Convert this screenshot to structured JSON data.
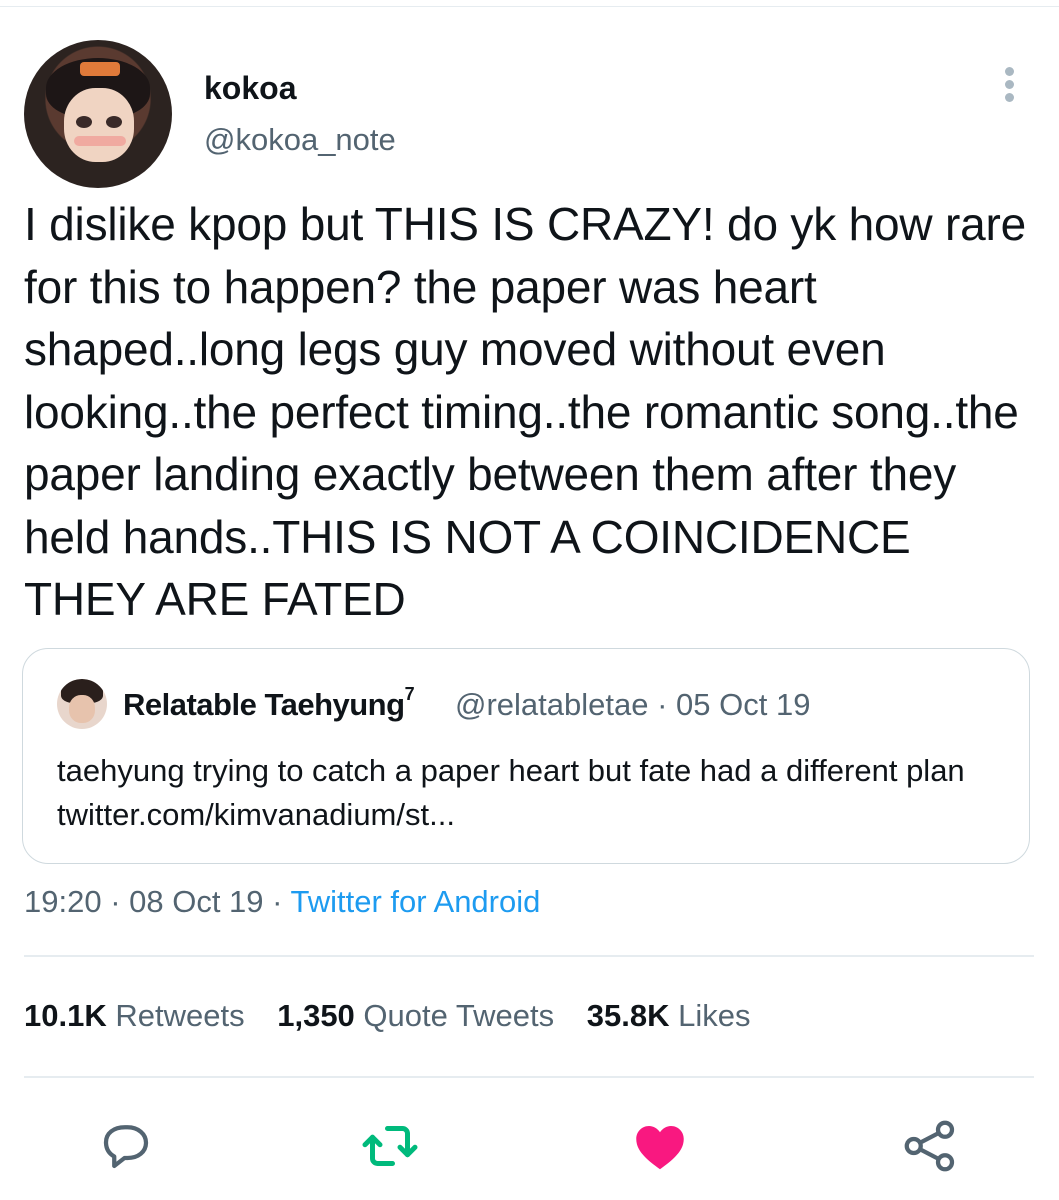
{
  "author": {
    "display_name": "kokoa",
    "handle": "@kokoa_note"
  },
  "tweet": {
    "text": "I dislike kpop but THIS IS CRAZY! do yk how rare for this to happen? the paper was heart shaped..long legs guy moved without even looking..the perfect timing..the romantic song..the paper landing exactly between them after they held hands..THIS IS NOT A COINCIDENCE THEY ARE FATED"
  },
  "quote": {
    "display_name": "Relatable Taehyung",
    "name_suffix": "7",
    "handle_date": "@relatabletae · 05 Oct 19",
    "text": "taehyung trying to catch a paper heart but fate had a different plan twitter.com/kimvanadium/st..."
  },
  "meta": {
    "time_date": "19:20 · 08 Oct 19 · ",
    "source": "Twitter for Android"
  },
  "stats": {
    "retweets_count": "10.1K",
    "retweets_label": "Retweets",
    "quotes_count": "1,350",
    "quotes_label": "Quote Tweets",
    "likes_count": "35.8K",
    "likes_label": "Likes"
  },
  "icons": {
    "reply": "reply-icon",
    "retweet": "retweet-icon",
    "like": "heart-icon",
    "share": "share-icon",
    "more": "more-icon"
  },
  "colors": {
    "retweet": "#00ba7c",
    "like": "#f91880",
    "link": "#1d9bf0",
    "secondary_text": "#536471"
  }
}
